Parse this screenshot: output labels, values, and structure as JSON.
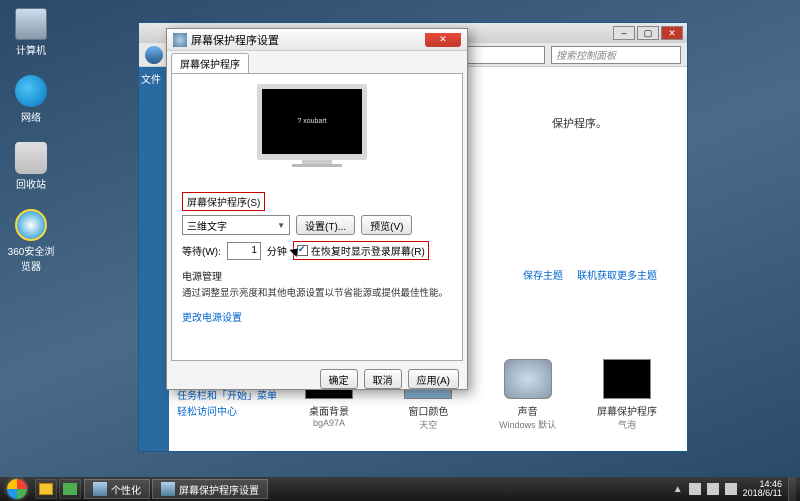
{
  "desktop_icons": {
    "computer": "计算机",
    "network": "网络",
    "recycle": "回收站",
    "browser360": "360安全浏览器"
  },
  "cp": {
    "search_placeholder": "搜索控制面板",
    "head_text": "保护程序。",
    "link_save_theme": "保存主题",
    "link_get_more": "联机获取更多主题",
    "item1_title": "桌面背景",
    "item1_sub": "bgA97A",
    "item2_title": "窗口颜色",
    "item2_sub": "天空",
    "item3_title": "声音",
    "item3_sub": "Windows 默认",
    "item4_title": "屏幕保护程序",
    "item4_sub": "气泡",
    "side_taskbar": "任务栏和「开始」菜单",
    "side_ease": "轻松访问中心"
  },
  "ss": {
    "title": "屏幕保护程序设置",
    "tab": "屏幕保护程序",
    "preview_text": "?  xoubart",
    "group_label": "屏幕保护程序(S)",
    "combo_value": "三维文字",
    "btn_settings": "设置(T)...",
    "btn_preview": "预览(V)",
    "wait_label": "等待(W):",
    "wait_value": "1",
    "wait_unit": "分钟",
    "chk_label": "在恢复时显示登录屏幕(R)",
    "power_h": "电源管理",
    "power_t": "通过调整显示亮度和其他电源设置以节省能源或提供最佳性能。",
    "power_link": "更改电源设置",
    "btn_ok": "确定",
    "btn_cancel": "取消",
    "btn_apply": "应用(A)"
  },
  "taskbar": {
    "task1": "个性化",
    "task2": "屏幕保护程序设置",
    "time": "14:46",
    "date": "2018/6/11"
  }
}
